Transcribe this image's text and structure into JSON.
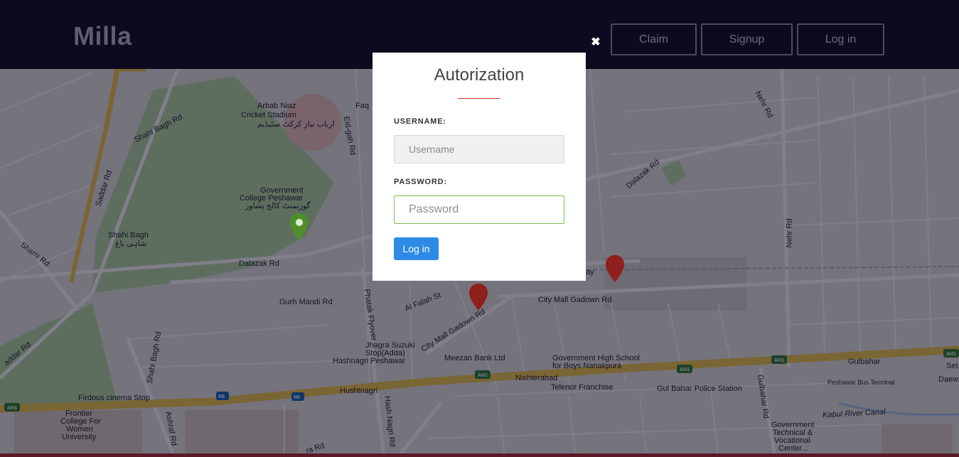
{
  "header": {
    "logo": "Milla",
    "nav": {
      "claim": "Claim",
      "signup": "Signup",
      "login": "Log in"
    }
  },
  "modal": {
    "close_glyph": "✖",
    "title": "Autorization",
    "username_label": "USERNAME:",
    "username_placeholder": "Username",
    "username_value": "",
    "password_label": "PASSWORD:",
    "password_placeholder": "Password",
    "password_value": "",
    "submit_label": "Log in",
    "accent_color": "#d0342c",
    "submit_color": "#2d8ae5",
    "focus_color": "#79c14b"
  },
  "map": {
    "labels": {
      "shahi_bagh_rd": "Shahi Bagh Rd",
      "arbab_niaz_1": "Arbab Niaz",
      "arbab_niaz_2": "Cricket Stadium",
      "arbab_niaz_urdu": "ارباب نیاز کرکٹ سٹیڈیم",
      "eid_gah_rd": "Eid-gah Rd",
      "faq": "Faq",
      "saddar_rd": "Saddar Rd",
      "govt_college_1": "Government",
      "govt_college_2": "College Peshawar",
      "govt_college_urdu": "گورنمنٹ کالج پشاور",
      "shahi_bagh": "Shahi Bagh",
      "shahi_bagh_urdu": "شاہی باغ",
      "shami_rd": "Shami Rd",
      "dalazak_rd_left": "Dalazak Rd",
      "dalazak_rd_right": "Dalazak Rd",
      "nehr_rd_top": "Nehr Rd",
      "nehr_rd": "Nehr Rd",
      "gurh_mandi_rd": "Gurh Mandi Rd",
      "al_falah_st": "Al Falah St",
      "phatak_flyover": "Phatak Flyover",
      "city_mall_gadown_rd": "City Mall Gadown Rd",
      "city_mall_gadown_rd_diag": "City Mall Gadown Rd",
      "jhagra_1": "Jhagra Suzuki",
      "jhagra_2": "Stop(Adda)",
      "hashnagri_peshawar": "Hashnagri Peshawar",
      "meezan_bank": "Meezan Bank Ltd",
      "govt_high_school_1": "Government High School",
      "govt_high_school_2": "for Boys Nanakpura",
      "gulbahar": "Gulbahar",
      "nishterabad": "Nishterabad",
      "telenor": "Telenor Franchise",
      "gul_bahar_police": "Gul Bahar Police Station",
      "gulbahar_rd": "Gulbahar Rd",
      "peshawar_bus_terminal": "Peshawar Bus Terminal",
      "daew": "Daew",
      "set": "Set",
      "firdous_cinema": "Firdous cinema Stop",
      "hushtnagri": "Hushtnagri",
      "hash_nagri_rd": "Hash Nagri Rd",
      "kabul_river_canal": "Kabul River Canal",
      "frontier_1": "Frontier",
      "frontier_2": "College For",
      "frontier_3": "Women",
      "frontier_4": "University",
      "ashraf_rd": "Ashraf Rd",
      "govt_tech_1": "Government",
      "govt_tech_2": "Technical &",
      "govt_tech_3": "Vocational",
      "govt_tech_4": "Center...",
      "ay": "ay",
      "ra_rd": "ra Rd",
      "addar_rd": "addar Rd",
      "shahi_bagh_rd_vertical": "Shahi Bagh Rd",
      "n5_a": "N5",
      "n5_b": "N5",
      "ah1_a": "AH1",
      "ah1_b": "AH1",
      "ah1_c": "AH1",
      "ah1_d": "AH1",
      "ah1_e": "AH1"
    }
  }
}
